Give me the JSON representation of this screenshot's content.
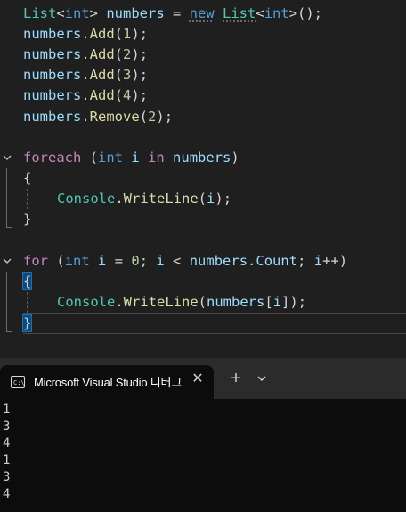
{
  "editor": {
    "lines": {
      "l1": {
        "t1": "List",
        "t2": "<",
        "t3": "int",
        "t4": "> ",
        "t5": "numbers",
        "t6": " = ",
        "t7": "new",
        "t8": " ",
        "t9": "List",
        "t10": "<",
        "t11": "int",
        "t12": ">();"
      },
      "l2": {
        "t1": "numbers",
        "t2": ".",
        "t3": "Add",
        "t4": "(",
        "t5": "1",
        "t6": ");"
      },
      "l3": {
        "t1": "numbers",
        "t2": ".",
        "t3": "Add",
        "t4": "(",
        "t5": "2",
        "t6": ");"
      },
      "l4": {
        "t1": "numbers",
        "t2": ".",
        "t3": "Add",
        "t4": "(",
        "t5": "3",
        "t6": ");"
      },
      "l5": {
        "t1": "numbers",
        "t2": ".",
        "t3": "Add",
        "t4": "(",
        "t5": "4",
        "t6": ");"
      },
      "l6": {
        "t1": "numbers",
        "t2": ".",
        "t3": "Remove",
        "t4": "(",
        "t5": "2",
        "t6": ");"
      },
      "l8": {
        "t1": "foreach",
        "t2": " (",
        "t3": "int",
        "t4": " ",
        "t5": "i",
        "t6": " ",
        "t7": "in",
        "t8": " ",
        "t9": "numbers",
        "t10": ")"
      },
      "l9": {
        "t1": "{"
      },
      "l10": {
        "t1": "Console",
        "t2": ".",
        "t3": "WriteLine",
        "t4": "(",
        "t5": "i",
        "t6": ");"
      },
      "l11": {
        "t1": "}"
      },
      "l13": {
        "t1": "for",
        "t2": " (",
        "t3": "int",
        "t4": " ",
        "t5": "i",
        "t6": " = ",
        "t7": "0",
        "t8": "; ",
        "t9": "i",
        "t10": " < ",
        "t11": "numbers",
        "t12": ".",
        "t13": "Count",
        "t14": "; ",
        "t15": "i",
        "t16": "++)"
      },
      "l14": {
        "t1": "{"
      },
      "l15": {
        "t1": "Console",
        "t2": ".",
        "t3": "WriteLine",
        "t4": "(",
        "t5": "numbers",
        "t6": "[",
        "t7": "i",
        "t8": "]);"
      },
      "l16": {
        "t1": "}"
      }
    }
  },
  "terminal": {
    "tab_title": "Microsoft Visual Studio 디버그",
    "close_glyph": "✕",
    "new_tab_glyph": "+",
    "output": [
      "1",
      "3",
      "4",
      "1",
      "3",
      "4"
    ]
  }
}
